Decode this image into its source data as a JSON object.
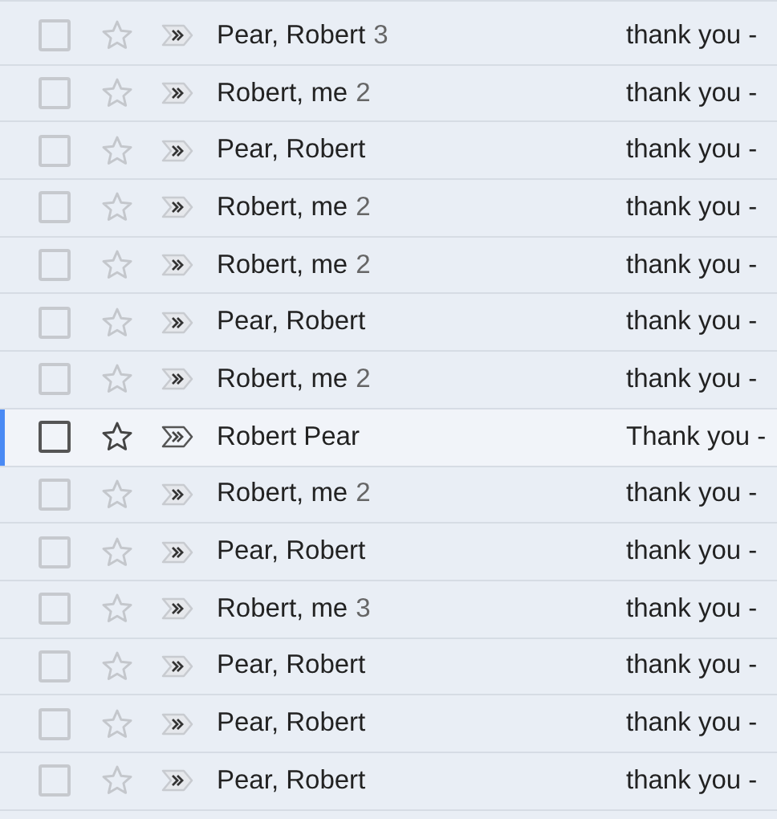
{
  "rows": [
    {
      "sender": "Pear, Robert",
      "count": "3",
      "snippet": "thank you -",
      "hovered": false
    },
    {
      "sender": "Robert, me",
      "count": "2",
      "snippet": "thank you -",
      "hovered": false
    },
    {
      "sender": "Pear, Robert",
      "snippet": "thank you -",
      "hovered": false
    },
    {
      "sender": "Robert, me",
      "count": "2",
      "snippet": "thank you -",
      "hovered": false
    },
    {
      "sender": "Robert, me",
      "count": "2",
      "snippet": "thank you -",
      "hovered": false
    },
    {
      "sender": "Pear, Robert",
      "snippet": "thank you -",
      "hovered": false
    },
    {
      "sender": "Robert, me",
      "count": "2",
      "snippet": "thank you -",
      "hovered": false
    },
    {
      "sender": "Robert Pear",
      "snippet": "Thank you -",
      "hovered": true
    },
    {
      "sender": "Robert, me",
      "count": "2",
      "snippet": "thank you -",
      "hovered": false
    },
    {
      "sender": "Pear, Robert",
      "snippet": "thank you -",
      "hovered": false
    },
    {
      "sender": "Robert, me",
      "count": "3",
      "snippet": "thank you -",
      "hovered": false
    },
    {
      "sender": "Pear, Robert",
      "snippet": "thank you -",
      "hovered": false
    },
    {
      "sender": "Pear, Robert",
      "snippet": "thank you -",
      "hovered": false
    },
    {
      "sender": "Pear, Robert",
      "snippet": "thank you -",
      "hovered": false
    }
  ]
}
